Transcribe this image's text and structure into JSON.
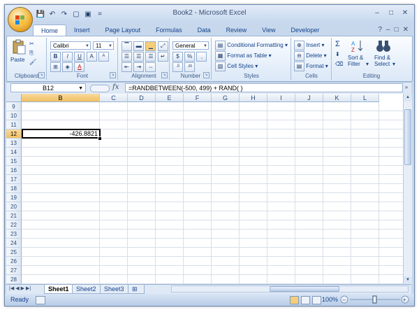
{
  "window": {
    "title": "Book2 - Microsoft Excel",
    "controls": [
      "–",
      "□",
      "✕"
    ]
  },
  "qat": {
    "icons": [
      "save-icon",
      "undo-icon",
      "redo-icon",
      "new-icon",
      "print-icon"
    ],
    "more": "="
  },
  "tabs": [
    "Home",
    "Insert",
    "Page Layout",
    "Formulas",
    "Data",
    "Review",
    "View",
    "Developer"
  ],
  "active_tab": "Home",
  "ribbon": {
    "clipboard": {
      "label": "Clipboard",
      "paste": "Paste"
    },
    "font": {
      "label": "Font",
      "name": "Calibri",
      "size": "11",
      "bold": "B",
      "italic": "I",
      "underline": "U",
      "grow": "A",
      "shrink": "A"
    },
    "alignment": {
      "label": "Alignment"
    },
    "number": {
      "label": "Number",
      "format": "General",
      "currency": "$",
      "percent": "%",
      "comma": ",",
      "inc_dec": ".0",
      "dec_dec": ".00"
    },
    "styles": {
      "label": "Styles",
      "conditional": "Conditional Formatting",
      "format_table": "Format as Table",
      "cell_styles": "Cell Styles"
    },
    "cells": {
      "label": "Cells",
      "insert": "Insert",
      "delete": "Delete",
      "format": "Format"
    },
    "editing": {
      "label": "Editing",
      "sum": "Σ",
      "sort_filter_1": "Sort &",
      "sort_filter_2": "Filter",
      "find_select_1": "Find &",
      "find_select_2": "Select"
    }
  },
  "formula_bar": {
    "name_box": "B12",
    "fx": "fx",
    "formula": "=RANDBETWEEN(-500, 499) + RAND( )"
  },
  "grid": {
    "columns": [
      "B",
      "C",
      "D",
      "E",
      "F",
      "G",
      "H",
      "I",
      "J",
      "K",
      "L"
    ],
    "rows": [
      "9",
      "10",
      "11",
      "12",
      "13",
      "14",
      "15",
      "16",
      "17",
      "18",
      "19",
      "20",
      "21",
      "22",
      "23",
      "24",
      "25",
      "26",
      "27",
      "28"
    ],
    "active_col": "B",
    "active_row": "12",
    "active_value": "-426.8821"
  },
  "sheets": [
    "Sheet1",
    "Sheet2",
    "Sheet3"
  ],
  "active_sheet": "Sheet1",
  "status": {
    "ready": "Ready",
    "zoom": "100%"
  }
}
